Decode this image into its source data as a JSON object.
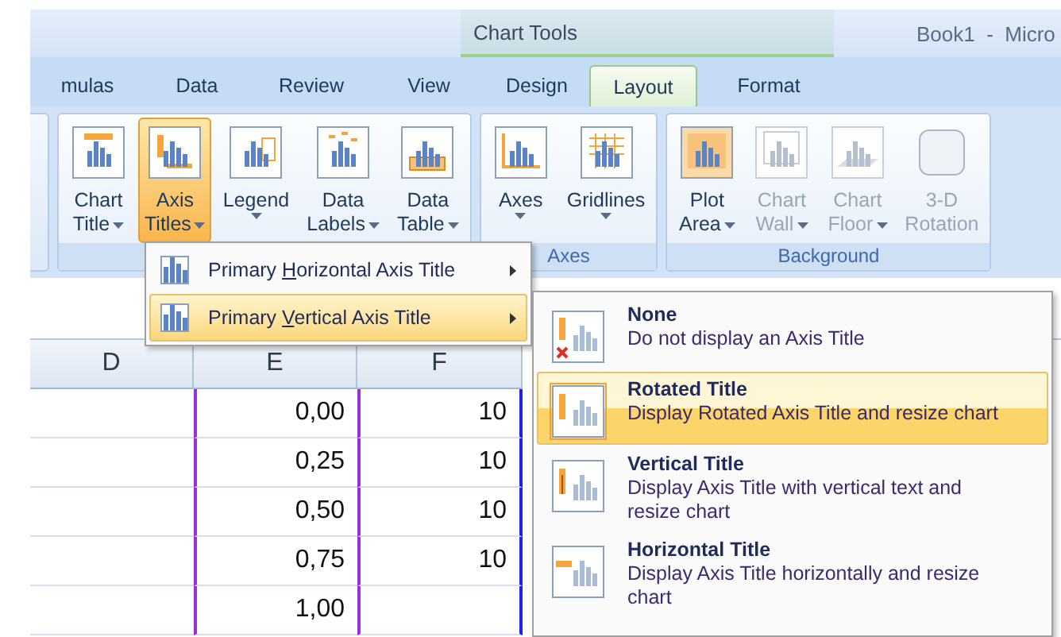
{
  "title_bar": {
    "contextual_group": "Chart Tools",
    "document_title": "Book1  -  Micro"
  },
  "tabs": [
    {
      "label": "mulas",
      "selected": false
    },
    {
      "label": "Data",
      "selected": false
    },
    {
      "label": "Review",
      "selected": false
    },
    {
      "label": "View",
      "selected": false
    },
    {
      "label": "Design",
      "selected": false
    },
    {
      "label": "Layout",
      "selected": true
    },
    {
      "label": "Format",
      "selected": false
    }
  ],
  "ribbon_groups": [
    {
      "buttons": [
        {
          "kind": "chart-title",
          "lines": [
            "Chart",
            "Title"
          ],
          "dropdown": true,
          "selected": false,
          "disabled": false
        },
        {
          "kind": "axis-titles",
          "lines": [
            "Axis",
            "Titles"
          ],
          "dropdown": true,
          "selected": true,
          "disabled": false
        },
        {
          "kind": "legend",
          "lines": [
            "Legend"
          ],
          "dropdown": true,
          "selected": false,
          "disabled": false
        },
        {
          "kind": "data-labels",
          "lines": [
            "Data",
            "Labels"
          ],
          "dropdown": true,
          "selected": false,
          "disabled": false
        },
        {
          "kind": "data-table",
          "lines": [
            "Data",
            "Table"
          ],
          "dropdown": true,
          "selected": false,
          "disabled": false
        }
      ]
    },
    {
      "label": "Axes",
      "buttons": [
        {
          "kind": "axes",
          "lines": [
            "Axes"
          ],
          "dropdown": true,
          "selected": false,
          "disabled": false
        },
        {
          "kind": "gridlines",
          "lines": [
            "Gridlines"
          ],
          "dropdown": true,
          "selected": false,
          "disabled": false
        }
      ]
    },
    {
      "label": "Background",
      "buttons": [
        {
          "kind": "plot-area",
          "lines": [
            "Plot",
            "Area"
          ],
          "dropdown": true,
          "selected": false,
          "disabled": false
        },
        {
          "kind": "chart-wall",
          "lines": [
            "Chart",
            "Wall"
          ],
          "dropdown": true,
          "selected": false,
          "disabled": true
        },
        {
          "kind": "chart-floor",
          "lines": [
            "Chart",
            "Floor"
          ],
          "dropdown": true,
          "selected": false,
          "disabled": true
        },
        {
          "kind": "rotation",
          "lines": [
            "3-D",
            "Rotation"
          ],
          "dropdown": false,
          "selected": false,
          "disabled": true
        }
      ]
    }
  ],
  "sheet": {
    "columns": [
      "D",
      "E",
      "F"
    ],
    "rows": [
      [
        "",
        "0,00",
        "10"
      ],
      [
        "",
        "0,25",
        "10"
      ],
      [
        "",
        "0,50",
        "10"
      ],
      [
        "",
        "0,75",
        "10"
      ],
      [
        "",
        "1,00",
        ""
      ]
    ]
  },
  "axis_titles_menu": [
    {
      "before": "Primary ",
      "accesskey": "H",
      "after": "orizontal Axis Title",
      "selected": false
    },
    {
      "before": "Primary ",
      "accesskey": "V",
      "after": "ertical Axis Title",
      "selected": true
    }
  ],
  "vertical_axis_submenu": [
    {
      "kind": "none",
      "title": "None",
      "description": "Do not display an Axis Title",
      "selected": false
    },
    {
      "kind": "rotated",
      "title": "Rotated Title",
      "description": "Display Rotated Axis Title and resize chart",
      "selected": true
    },
    {
      "kind": "vertical",
      "title": "Vertical Title",
      "description": "Display Axis Title with vertical text and resize chart",
      "selected": false
    },
    {
      "kind": "horizontal",
      "title": "Horizontal Title",
      "description": "Display Axis Title horizontally and resize chart",
      "selected": false
    }
  ]
}
